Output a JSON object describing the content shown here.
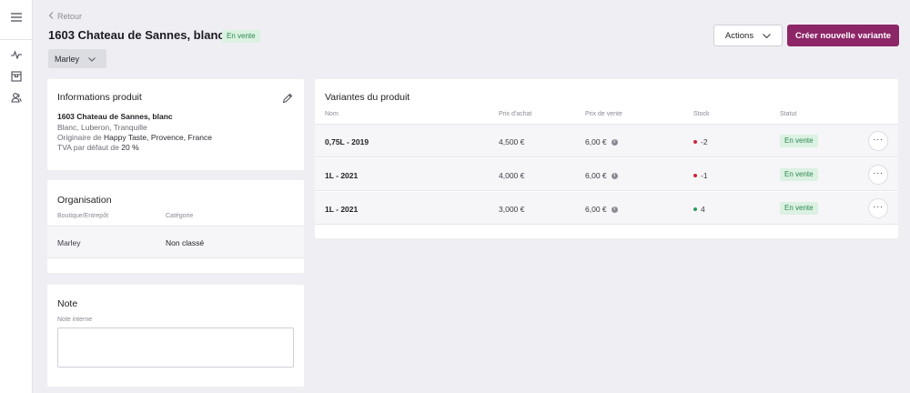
{
  "nav": {
    "back_label": "Retour"
  },
  "product": {
    "title": "1603 Chateau de Sannes, blanc",
    "status": "En vente"
  },
  "store_select": {
    "value": "Marley"
  },
  "header": {
    "actions_label": "Actions",
    "create_variant_label": "Créer nouvelle variante"
  },
  "info_card": {
    "title": "Informations produit",
    "name": "1603 Chateau de Sannes, blanc",
    "line1": "Blanc, Luberon, Tranquille",
    "origin_prefix": "Originaire de",
    "origin_value": "Happy Taste, Provence, France",
    "tva_prefix": "TVA par défaut de",
    "tva_value": "20 %"
  },
  "org_card": {
    "title": "Organisation",
    "col_store": "Boutique/Entrepôt",
    "col_category": "Catégorie",
    "store": "Marley",
    "category": "Non classé"
  },
  "note_card": {
    "title": "Note",
    "label": "Note interne",
    "value": ""
  },
  "variants_card": {
    "title": "Variantes du produit",
    "columns": {
      "name": "Nom",
      "buy": "Prix d'achat",
      "sell": "Prix de vente",
      "stock": "Stock",
      "status": "Statut"
    },
    "rows": [
      {
        "name": "0,75L - 2019",
        "buy": "4,500 €",
        "sell": "6,00 €",
        "stock": "-2",
        "status": "En vente"
      },
      {
        "name": "1L - 2021",
        "buy": "4,000 €",
        "sell": "6,00 €",
        "stock": "-1",
        "status": "En vente"
      },
      {
        "name": "1L - 2021",
        "buy": "3,000 €",
        "sell": "6,00 €",
        "stock": "4",
        "status": "En vente"
      }
    ]
  },
  "colors": {
    "brand": "#8c2667",
    "badge_bg": "#dbf1e2",
    "badge_text": "#2e8a52",
    "stock_negative": "#d0243c",
    "stock_positive": "#2e9a5a"
  },
  "icons": {
    "menu": "menu-icon",
    "activity": "activity-icon",
    "store": "store-icon",
    "users": "users-icon",
    "back": "chevron-left-icon",
    "edit": "pencil-icon",
    "more": "more-horizontal-icon",
    "info": "info-icon"
  }
}
